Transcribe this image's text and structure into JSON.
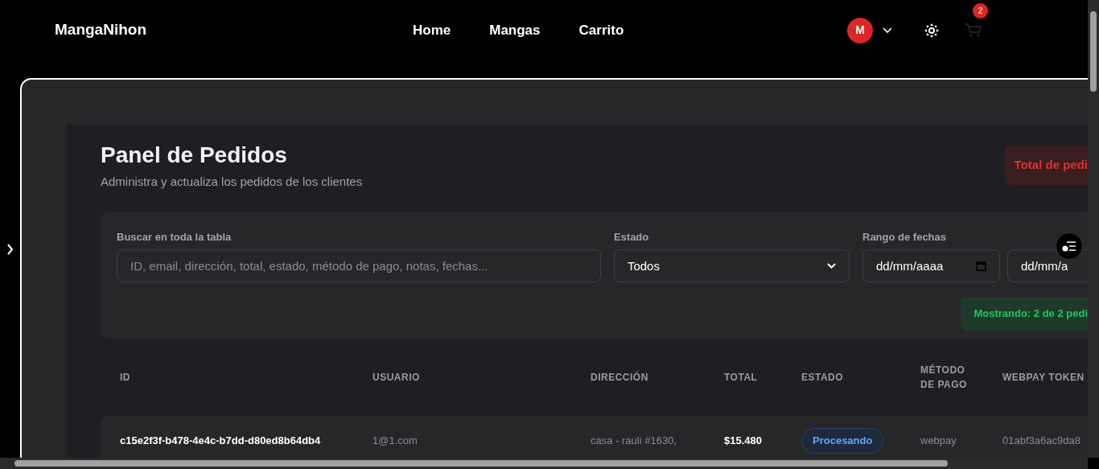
{
  "navbar": {
    "brand": "MangaNihon",
    "links": [
      {
        "label": "Home"
      },
      {
        "label": "Mangas"
      },
      {
        "label": "Carrito"
      }
    ],
    "avatar": "M",
    "cart_count": "2"
  },
  "panel": {
    "title": "Panel de Pedidos",
    "subtitle": "Administra y actualiza los pedidos de los clientes",
    "total_badge": "Total de pedi"
  },
  "filters": {
    "search": {
      "label": "Buscar en toda la tabla",
      "placeholder": "ID, email, dirección, total, estado, método de pago, notas, fechas..."
    },
    "status": {
      "label": "Estado",
      "value": "Todos"
    },
    "date_range": {
      "label": "Rango de fechas",
      "from": "dd/mm/aaaa",
      "to": "dd/mm/a"
    },
    "count_badge": "Mostrando: 2 de 2 pedi"
  },
  "table": {
    "columns": [
      "ID",
      "USUARIO",
      "DIRECCIÓN",
      "TOTAL",
      "ESTADO",
      "MÉTODO DE PAGO",
      "WEBPAY TOKEN"
    ],
    "rows": [
      {
        "id": "c15e2f3f-b478-4e4c-b7dd-d80ed8b64db4",
        "user": "1@1.com",
        "address": "casa - rauli #1630,",
        "total": "$15.480",
        "status": "Procesando",
        "method": "webpay",
        "token": "01abf3a6ac9da8"
      }
    ]
  }
}
